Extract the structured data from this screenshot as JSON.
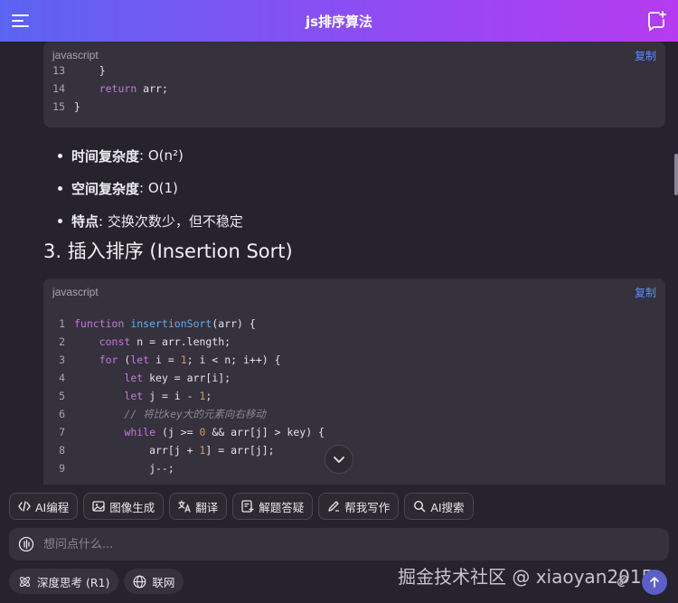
{
  "header": {
    "title": "js排序算法"
  },
  "code_block_1": {
    "language": "javascript",
    "copy_label": "复制",
    "lines": [
      {
        "n": "13",
        "code": "    }"
      },
      {
        "n": "14",
        "code": "    return arr;"
      },
      {
        "n": "15",
        "code": "}"
      }
    ]
  },
  "bullets": [
    {
      "label": "时间复杂度",
      "text": ": O(n²)"
    },
    {
      "label": "空间复杂度",
      "text": ": O(1)"
    },
    {
      "label": "特点",
      "text": ": 交换次数少，但不稳定"
    }
  ],
  "section_heading": "3. 插入排序 (Insertion Sort)",
  "code_block_2": {
    "language": "javascript",
    "copy_label": "复制",
    "lines": [
      {
        "n": "1",
        "code": "function insertionSort(arr) {"
      },
      {
        "n": "2",
        "code": "    const n = arr.length;"
      },
      {
        "n": "3",
        "code": "    for (let i = 1; i < n; i++) {"
      },
      {
        "n": "4",
        "code": "        let key = arr[i];"
      },
      {
        "n": "5",
        "code": "        let j = i - 1;"
      },
      {
        "n": "6",
        "code": "        // 将比key大的元素向右移动"
      },
      {
        "n": "7",
        "code": "        while (j >= 0 && arr[j] > key) {"
      },
      {
        "n": "8",
        "code": "            arr[j + 1] = arr[j];"
      },
      {
        "n": "9",
        "code": "            j--;"
      }
    ]
  },
  "toolbar": [
    {
      "label": "AI编程",
      "icon": "code-icon"
    },
    {
      "label": "图像生成",
      "icon": "image-icon"
    },
    {
      "label": "翻译",
      "icon": "translate-icon"
    },
    {
      "label": "解题答疑",
      "icon": "question-icon"
    },
    {
      "label": "帮我写作",
      "icon": "pen-icon"
    },
    {
      "label": "AI搜索",
      "icon": "search-icon"
    }
  ],
  "input": {
    "placeholder": "想问点什么..."
  },
  "bottom": {
    "deep_think": "深度思考 (R1)",
    "web": "联网"
  },
  "watermark": "掘金技术社区 @ xiaoyan2015",
  "colors": {
    "accent": "#5b8cff",
    "header_start": "#5b64f0",
    "header_end": "#b63bf0"
  }
}
